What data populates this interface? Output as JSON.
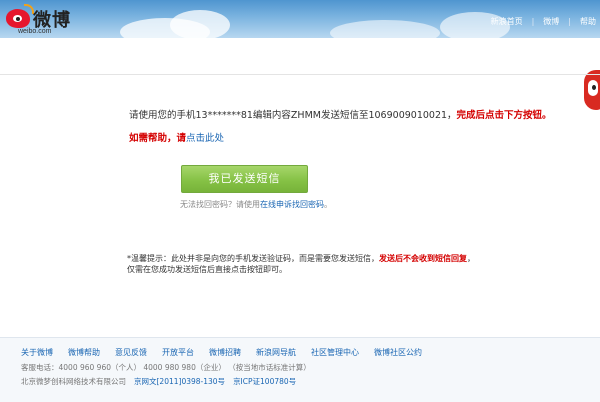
{
  "header": {
    "logo_text": "微博",
    "logo_domain": "weibo.com",
    "nav": [
      "新浪首页",
      "微博",
      "帮助"
    ]
  },
  "main": {
    "instruction_prefix": "请使用您的手机13*******81编辑内容ZHMM发送短信至1069009010021，",
    "instruction_emphasis": "完成后点击下方按钮。",
    "help_prefix": "如需帮助，请",
    "help_link": "点击此处",
    "send_button": "我已发送短信",
    "recover_prefix": "无法找回密码？请使用",
    "recover_link": "在线申诉找回密码",
    "recover_suffix": "。",
    "tip_prefix": "*温馨提示：此处并非是向您的手机发送验证码，而是需要您发送短信，",
    "tip_emphasis": "发送后不会收到短信回复",
    "tip_suffix": "，",
    "tip_line2": "仅需在您成功发送短信后直接点击按钮即可。"
  },
  "footer": {
    "links": [
      "关于微博",
      "微博帮助",
      "意见反馈",
      "开放平台",
      "微博招聘",
      "新浪网导航",
      "社区管理中心",
      "微博社区公约"
    ],
    "contact": "客服电话：4000 960 960（个人）  4000 980 980（企业）  （按当地市话标准计算）",
    "company": "北京微梦创科网络技术有限公司",
    "license1": "京网文[2011]0398-130号",
    "license2": "京ICP证100780号"
  },
  "colors": {
    "accent_red": "#d40000",
    "link_blue": "#1a66b3",
    "button_green": "#86c246"
  }
}
